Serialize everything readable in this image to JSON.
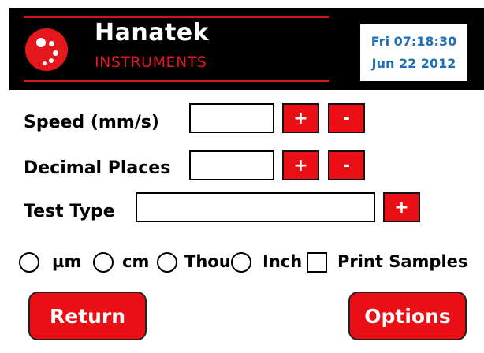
{
  "header": {
    "brand_name": "Hanatek",
    "brand_sub": "INSTRUMENTS",
    "datetime_line1": "Fri 07:18:30",
    "datetime_line2": "Jun 22 2012"
  },
  "form": {
    "speed": {
      "label": "Speed (mm/s)",
      "value": "",
      "plus": "+",
      "minus": "-"
    },
    "decimal_places": {
      "label": "Decimal Places",
      "value": "",
      "plus": "+",
      "minus": "-"
    },
    "test_type": {
      "label": "Test Type",
      "value": "",
      "plus": "+"
    }
  },
  "units": {
    "options": [
      "µm",
      "cm",
      "Thou",
      "Inch"
    ],
    "selected": null,
    "print_samples_label": "Print Samples",
    "print_samples_checked": false
  },
  "buttons": {
    "return": "Return",
    "options": "Options"
  },
  "colors": {
    "accent_red": "#ea0f14",
    "header_bg": "#000000",
    "date_text": "#1e6fb6"
  }
}
